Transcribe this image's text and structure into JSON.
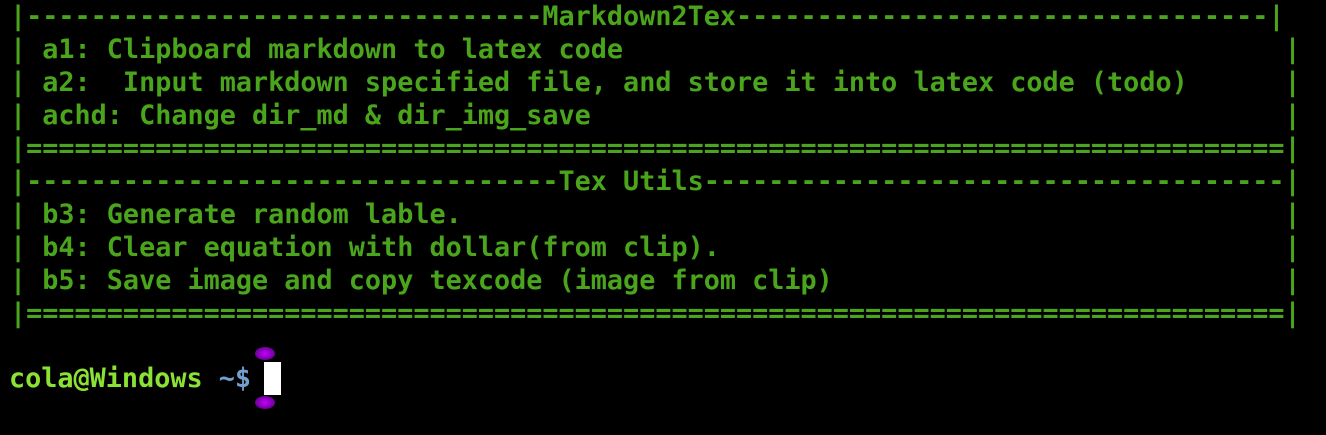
{
  "menu": {
    "lines": [
      "|--------------------------------Markdown2Tex---------------------------------|",
      "| a1: Clipboard markdown to latex code                                         |",
      "| a2:  Input markdown specified file, and store it into latex code (todo)      |",
      "| achd: Change dir_md & dir_img_save                                           |",
      "|==============================================================================|",
      "|---------------------------------Tex Utils------------------------------------|",
      "| b3: Generate random lable.                                                   |",
      "| b4: Clear equation with dollar(from clip).                                   |",
      "| b5: Save image and copy texcode (image from clip)                            |",
      "|==============================================================================|"
    ]
  },
  "prompt": {
    "user_host": "cola@Windows",
    "path": " ~$ "
  },
  "colors": {
    "menu_text": "#4aa51c",
    "prompt_user": "#8ae234",
    "prompt_path": "#729fcf",
    "background": "#000000",
    "cursor": "#ffffff",
    "ibeam": "#c300ff"
  },
  "icons": {
    "ibeam": "text-ibeam-cursor-icon"
  }
}
